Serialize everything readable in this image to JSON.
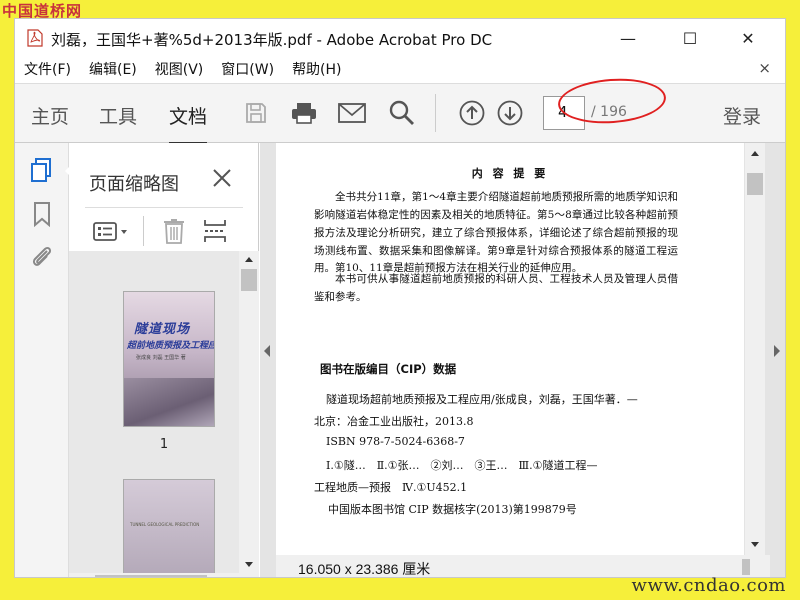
{
  "watermarks": {
    "top": "中国道桥网",
    "bottom": "www.cndao.com"
  },
  "window": {
    "title": "刘磊，王国华+著%5d+2013年版.pdf - Adobe Acrobat Pro DC",
    "minimize": "—",
    "maximize": "☐",
    "close": "✕"
  },
  "menu": {
    "items": [
      "文件(F)",
      "编辑(E)",
      "视图(V)",
      "窗口(W)",
      "帮助(H)"
    ],
    "close": "×"
  },
  "toolbar": {
    "tabs": [
      "主页",
      "工具",
      "文档"
    ],
    "active_tab": "文档",
    "page_current": "4",
    "page_total": "/ 196",
    "login": "登录"
  },
  "thumbnails_panel": {
    "title": "页面缩略图",
    "thumb1_label": "1",
    "thumb1_title": "隧道现场",
    "thumb1_subtitle": "超前地质预报及工程应用",
    "thumb1_authors": "张成良  刘磊  王国华  著",
    "thumb2_text": "TUNNEL GEOLOGICAL PREDICTION"
  },
  "page_content": {
    "heading": "内 容 提 要",
    "paragraph1": "全书共分11章，第1～4章主要介绍隧道超前地质预报所需的地质学知识和影响隧道岩体稳定性的因素及相关的地质特征。第5～8章通过比较各种超前预报方法及理论分析研究，建立了综合预报体系，详细论述了综合超前预报的现场测线布置、数据采集和图像解译。第9章是针对综合预报体系的隧道工程运用。第10、11章是超前预报方法在相关行业的延伸应用。",
    "paragraph2": "本书可供从事隧道超前地质预报的科研人员、工程技术人员及管理人员借鉴和参考。",
    "cip_title": "图书在版编目（CIP）数据",
    "cip_lines": [
      "隧道现场超前地质预报及工程应用/张成良，刘磊，王国华著．—",
      "北京：冶金工业出版社，2013.8",
      "ISBN 978-7-5024-6368-7",
      "Ⅰ.①隧…　Ⅱ.①张…　②刘…　③王…　Ⅲ.①隧道工程—",
      "工程地质—预报　Ⅳ.①U452.1",
      "中国版本图书馆 CIP 数据核字(2013)第199879号"
    ]
  },
  "status_bar": {
    "page_size": "16.050 x 23.386 厘米"
  },
  "colors": {
    "accent_blue": "#1f6fd1",
    "annotation_red": "#e02020",
    "frame_yellow": "#f6ef3a"
  }
}
